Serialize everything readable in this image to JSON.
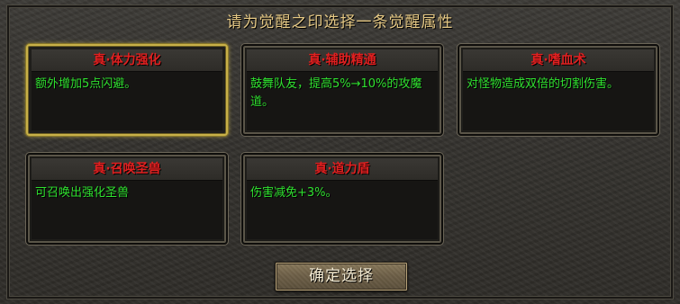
{
  "dialog": {
    "title": "请为觉醒之印选择一条觉醒属性",
    "confirm_label": "确定选择"
  },
  "options": [
    {
      "name": "真·体力强化",
      "desc": "额外增加5点闪避。",
      "selected": true
    },
    {
      "name": "真·辅助精通",
      "desc": "鼓舞队友，提高5%→10%的攻魔道。",
      "selected": false
    },
    {
      "name": "真·嗜血术",
      "desc": "对怪物造成双倍的切割伤害。",
      "selected": false
    },
    {
      "name": "真·召唤圣兽",
      "desc": "可召唤出强化圣兽",
      "selected": false
    },
    {
      "name": "真·道力盾",
      "desc": "伤害减免+3%。",
      "selected": false
    }
  ],
  "colors": {
    "option_name": "#e02020",
    "option_desc": "#2fe02f",
    "title": "#e6c985",
    "selected_border": "#c8b048"
  }
}
